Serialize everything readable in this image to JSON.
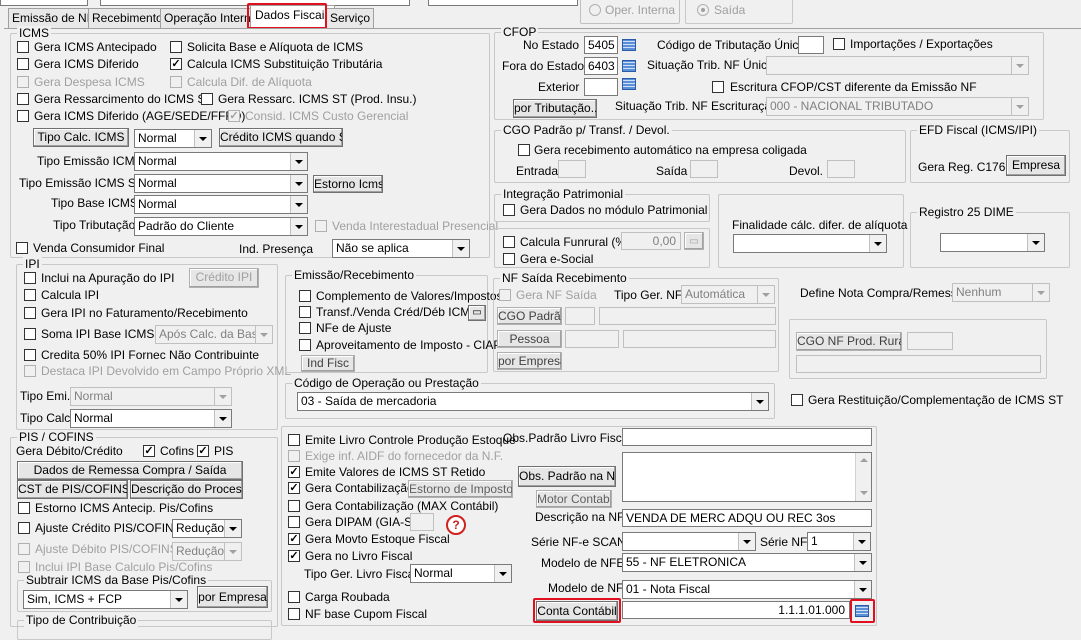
{
  "tabs": {
    "emissao": "Emissão de NF",
    "recebimento": "Recebimento",
    "operacao": "Operação Interna",
    "dados_fiscais": "Dados Fiscais",
    "servico": "Serviço"
  },
  "top": {
    "oper_interna": "Oper. Interna",
    "saida": "Saída"
  },
  "icms": {
    "title": "ICMS",
    "gera_antecipado": "Gera ICMS Antecipado",
    "solicita_base": "Solicita Base e Alíquota de ICMS",
    "gera_diferido": "Gera ICMS Diferido",
    "calcula_st": "Calcula ICMS Substituição Tributária",
    "gera_despesa": "Gera Despesa ICMS",
    "calcula_dif": "Calcula Dif. de Alíquota",
    "gera_ressarcimento": "Gera Ressarcimento do ICMS ST",
    "gera_ressarc_prod": "Gera Ressarc. ICMS ST (Prod. Insu.)",
    "gera_diferido_age": "Gera ICMS Diferido (AGE/SEDE/FFFD)",
    "consid_custo": "Consid. ICMS Custo Gerencial",
    "tipo_calc_btn": "Tipo Calc. ICMS",
    "tipo_calc_val": "Normal",
    "credito_st_btn": "Crédito ICMS quando ST",
    "tipo_emissao_lbl": "Tipo Emissão ICMS",
    "tipo_emissao_val": "Normal",
    "tipo_emissao_st_lbl": "Tipo Emissão ICMS ST",
    "tipo_emissao_st_val": "Normal",
    "estorno_btn": "Estorno Icms",
    "tipo_base_lbl": "Tipo Base ICMS",
    "tipo_base_val": "Normal",
    "tipo_trib_lbl": "Tipo Tributação",
    "tipo_trib_val": "Padrão do Cliente",
    "venda_inter": "Venda Interestadual Presencial",
    "venda_consumidor": "Venda Consumidor Final",
    "ind_presenca_lbl": "Ind. Presença",
    "ind_presenca_val": "Não se aplica"
  },
  "ipi": {
    "title": "IPI",
    "inclui_apuracao": "Inclui na Apuração do IPI",
    "credito_btn": "Crédito IPI",
    "calcula": "Calcula IPI",
    "gera_faturamento": "Gera IPI no Faturamento/Recebimento",
    "soma_base": "Soma IPI Base ICMS",
    "apos_calc": "Após Calc. da Base",
    "credita_50": "Credita 50% IPI Fornec Não Contribuinte",
    "destaca": "Destaca IPI Devolvido em Campo Próprio XML",
    "tipo_emi_lbl": "Tipo Emi.",
    "tipo_emi_val": "Normal",
    "tipo_calc_lbl": "Tipo Calc.",
    "tipo_calc_val": "Normal"
  },
  "pis": {
    "title": "PIS / COFINS",
    "gera_debito": "Gera Débito/Crédito",
    "cofins": "Cofins",
    "pis": "PIS",
    "dados_remessa_btn": "Dados de Remessa Compra / Saída",
    "cst_btn": "CST de PIS/COFINS",
    "descricao_btn": "Descrição do Processo",
    "estorno_antecip": "Estorno ICMS Antecip. Pis/Cofins",
    "ajuste_credito": "Ajuste Crédito PIS/COFINS",
    "ajuste_credito_val": "Redução",
    "ajuste_debito": "Ajuste Débito PIS/COFINS",
    "ajuste_debito_val": "Redução",
    "inclui_ipi": "Inclui IPI Base Calculo Pis/Cofins",
    "subtrair_title": "Subtrair ICMS da Base Pis/Cofins",
    "subtrair_val": "Sim, ICMS + FCP",
    "por_empresa_btn": "por Empresa",
    "tipo_contribuicao": "Tipo de Contribuição"
  },
  "cfop": {
    "title": "CFOP",
    "no_estado_lbl": "No Estado",
    "no_estado_val": "5405",
    "fora_estado_lbl": "Fora do Estado",
    "fora_estado_val": "6403",
    "exterior_lbl": "Exterior",
    "exterior_val": "",
    "por_trib_btn": "por Tributação...",
    "cod_trib_lbl": "Código de Tributação Único",
    "importacoes": "Importações / Exportações",
    "sit_trib_lbl": "Situação Trib. NF Única",
    "escritura_cfop": "Escritura CFOP/CST diferente da Emissão NF",
    "sit_trib_esc_lbl": "Situação Trib. NF Escrituração",
    "sit_trib_esc_val": "000 - NACIONAL TRIBUTADO"
  },
  "cgo": {
    "title": "CGO Padrão p/ Transf. / Devol.",
    "gera_receb": "Gera recebimento automático na empresa coligada",
    "entrada": "Entrada",
    "saida": "Saída",
    "devol": "Devol."
  },
  "efd": {
    "title": "EFD Fiscal (ICMS/IPI)",
    "gera_reg": "Gera Reg. C176",
    "empresa_btn": "Empresa"
  },
  "integracao": {
    "title": "Integração Patrimonial",
    "gera_dados": "Gera Dados no módulo Patrimonial"
  },
  "funrural": {
    "calcula": "Calcula Funrural (%)",
    "valor": "0,00",
    "gera_esocial": "Gera e-Social"
  },
  "finalidade": {
    "label": "Finalidade cálc. difer. de alíquota"
  },
  "registro25": {
    "title": "Registro 25 DIME"
  },
  "emissao": {
    "title": "Emissão/Recebimento",
    "complemento": "Complemento de Valores/Impostos",
    "transf_venda": "Transf./Venda Créd/Déb ICMS",
    "nfe_ajuste": "NFe de Ajuste",
    "aproveitamento": "Aproveitamento de Imposto - CIAP",
    "ind_fisc_btn": "Ind Fisc"
  },
  "nfsaida": {
    "title": "NF Saída Recebimento",
    "gera_nf": "Gera NF Saída",
    "tipo_ger_lbl": "Tipo Ger. NF",
    "tipo_ger_val": "Automática",
    "cgo_padrao_btn": "CGO Padrão",
    "pessoa_btn": "Pessoa",
    "por_empresa_btn": "por Empresa"
  },
  "define_nota": {
    "label": "Define Nota Compra/Remessa",
    "val": "Nenhum"
  },
  "cgo_rural": {
    "btn": "CGO NF Prod. Rural"
  },
  "codigo_operacao": {
    "title": "Código de Operação ou Prestação",
    "val": "03 - Saída de mercadoria"
  },
  "gera_restituicao": "Gera Restituição/Complementação de ICMS ST",
  "livro": {
    "emite_livro": "Emite Livro Controle Produção Estoque",
    "exige_aidf": "Exige inf. AIDF do fornecedor da N.F.",
    "emite_valores": "Emite Valores de ICMS ST Retido",
    "gera_contab": "Gera Contabilização",
    "estorno_impostos_btn": "Estorno de Impostos",
    "gera_contab_max": "Gera Contabilização (MAX Contábil)",
    "gera_dipam": "Gera DIPAM (GIA-SP)",
    "gera_movto": "Gera Movto Estoque Fiscal",
    "gera_livro": "Gera no Livro Fiscal",
    "tipo_ger_livro_lbl": "Tipo Ger. Livro Fiscal",
    "tipo_ger_livro_val": "Normal",
    "carga_roubada": "Carga Roubada",
    "nf_base_cupom": "NF base Cupom Fiscal"
  },
  "obs": {
    "padrao_livro_lbl": "Obs.Padrão Livro Fiscal",
    "padrao_nf_btn": "Obs. Padrão na NF",
    "motor_contab_btn": "Motor Contab.",
    "descricao_lbl": "Descrição na NF",
    "descricao_val": "VENDA DE MERC ADQU OU REC 3os",
    "serie_scan_lbl": "Série NF-e SCAN",
    "serie_nf_lbl": "Série NF",
    "serie_nf_val": "1",
    "modelo_nfe_lbl": "Modelo de NFE",
    "modelo_nfe_val": "55 - NF ELETRONICA",
    "modelo_nf_lbl": "Modelo de NF",
    "modelo_nf_val": "01 - Nota Fiscal",
    "conta_contabil_lbl": "Conta Contábil",
    "conta_contabil_val": "1.1.1.01.000"
  },
  "colors": {
    "highlight": "#e01020",
    "icon_blue": "#5b8fd6"
  },
  "icons": {
    "lookup": "grid-list-icon",
    "help": "question-icon"
  }
}
